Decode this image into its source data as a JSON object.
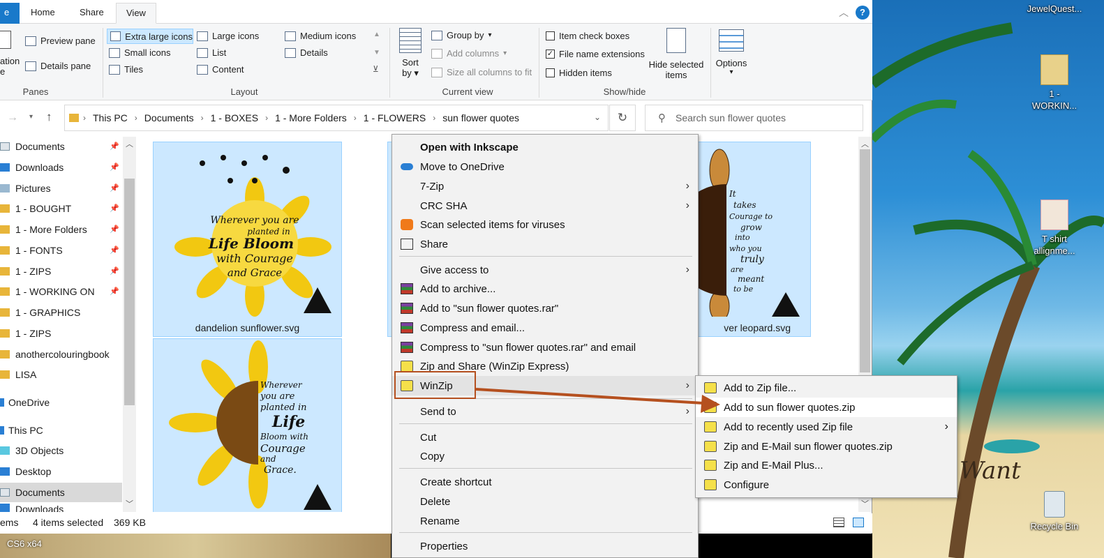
{
  "ribbon": {
    "tabs": {
      "file": "e",
      "home": "Home",
      "share": "Share",
      "view": "View"
    },
    "panes": {
      "preview": "Preview pane",
      "details": "Details pane",
      "nav_a": "ation",
      "nav_b": "e",
      "label": "Panes"
    },
    "layout": {
      "extra_large": "Extra large icons",
      "large": "Large icons",
      "medium": "Medium icons",
      "small": "Small icons",
      "list": "List",
      "details": "Details",
      "tiles": "Tiles",
      "content": "Content",
      "label": "Layout"
    },
    "current_view": {
      "sort_a": "Sort",
      "sort_b": "by",
      "group_by": "Group by",
      "add_columns": "Add columns",
      "size_columns": "Size all columns to fit",
      "label": "Current view"
    },
    "show_hide": {
      "item_checkboxes": "Item check boxes",
      "file_name_ext": "File name extensions",
      "hidden_items": "Hidden items",
      "hide_selected_a": "Hide selected",
      "hide_selected_b": "items",
      "label": "Show/hide"
    },
    "options": "Options"
  },
  "address": {
    "crumbs": [
      "This PC",
      "Documents",
      "1 - BOXES",
      "1 - More Folders",
      "1 - FLOWERS",
      "sun flower quotes"
    ],
    "search_placeholder": "Search sun flower quotes"
  },
  "nav": [
    "Documents",
    "Downloads",
    "Pictures",
    "1 - BOUGHT",
    "1 - More Folders",
    "1 - FONTS",
    "1 - ZIPS",
    "1 - WORKING ON",
    "1 - GRAPHICS",
    "1 - ZIPS",
    "anothercolouringbook",
    "LISA",
    "OneDrive",
    "This PC",
    "3D Objects",
    "Desktop",
    "Documents",
    "Downloads"
  ],
  "files": {
    "f1": "dandelion sunflower.svg",
    "f2": "ver leopard.svg",
    "q1": [
      "Wherever you are",
      "planted in",
      "Life Bloom",
      "with Courage",
      "and Grace"
    ],
    "q2": [
      "Wherever",
      "you are",
      "planted in",
      "Life",
      "Bloom with",
      "Courage",
      "and",
      "Grace."
    ],
    "q3": [
      "It",
      "takes",
      "Courage to",
      "grow",
      "into",
      "who you",
      "truly",
      "are",
      "meant",
      "to be"
    ]
  },
  "status": {
    "items_prefix": "ems",
    "selected": "4 items selected",
    "size": "369 KB"
  },
  "context_menu": {
    "open_with": "Open with Inkscape",
    "onedrive": "Move to OneDrive",
    "zip7": "7-Zip",
    "crc": "CRC SHA",
    "scan": "Scan selected items for viruses",
    "share": "Share",
    "give_access": "Give access to",
    "add_archive": "Add to archive...",
    "add_rar": "Add to \"sun flower quotes.rar\"",
    "compress_email": "Compress and email...",
    "compress_rar_email": "Compress to \"sun flower quotes.rar\" and email",
    "zip_share": "Zip and Share (WinZip Express)",
    "winzip": "WinZip",
    "send_to": "Send to",
    "cut": "Cut",
    "copy": "Copy",
    "create_shortcut": "Create shortcut",
    "delete": "Delete",
    "rename": "Rename",
    "properties": "Properties"
  },
  "winzip_submenu": [
    "Add to Zip file...",
    "Add to sun flower quotes.zip",
    "Add to recently used Zip file",
    "Zip and E-Mail sun flower quotes.zip",
    "Zip and E-Mail Plus...",
    "Configure"
  ],
  "desktop": {
    "jewel": "JewelQuest...",
    "working_a": "1 -",
    "working_b": "WORKIN...",
    "tshirt_a": "T shirt",
    "tshirt_b": "allignme...",
    "recycle": "Recycle Bin",
    "want": "Want",
    "taskbar_app": "CS6 x64"
  },
  "colors": {
    "accent": "#1979ca",
    "selection": "#cce8ff",
    "annotation": "#b5501f"
  }
}
